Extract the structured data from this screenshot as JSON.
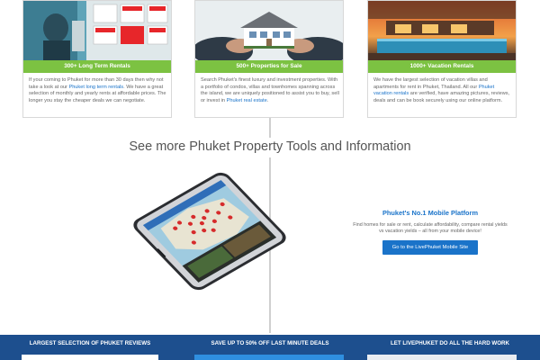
{
  "cards": [
    {
      "banner": "300+ Long Term Rentals",
      "text_before": "If your coming to Phuket for more than 30 days then why not take a look at our ",
      "link": "Phuket long term rentals",
      "text_after": ". We have a great selection of monthly and yearly rents at affordable prices. The longer you stay the cheaper deals we can negotiate."
    },
    {
      "banner": "500+ Properties for Sale",
      "text_before": "Search Phuket's finest luxury and investment properties. With a portfolio of condos, villas and townhomes spanning across the island, we are uniquely positioned to assist you to buy, sell or invest in ",
      "link": "Phuket real estate",
      "text_after": "."
    },
    {
      "banner": "1000+ Vacation Rentals",
      "text_before": "We have the largest selection of vacation villas and apartments for rent in Phuket, Thailand. All our ",
      "link": "Phuket vacation rentals",
      "text_after": " are verified, have amazing pictures, reviews, deals and can be book securely using our online platform."
    }
  ],
  "section_title": "See more Phuket Property Tools and Information",
  "platform": {
    "title": "Phuket's No.1 Mobile Platform",
    "description": "Find homes for sale or rent, calculate affordability, compare rental yields vs vacation yields – all from your mobile device!",
    "button": "Go to the LivePhuket Mobile Site"
  },
  "phone": {
    "price": "$260,000"
  },
  "footer": [
    "LARGEST SELECTION OF PHUKET REVIEWS",
    "SAVE UP TO 50% OFF LAST MINUTE DEALS",
    "LET LIVEPHUKET DO ALL THE HARD WORK"
  ],
  "colors": {
    "green_banner": "#7cc242",
    "link_blue": "#1a73c9",
    "footer_blue": "#1d4f8e"
  }
}
